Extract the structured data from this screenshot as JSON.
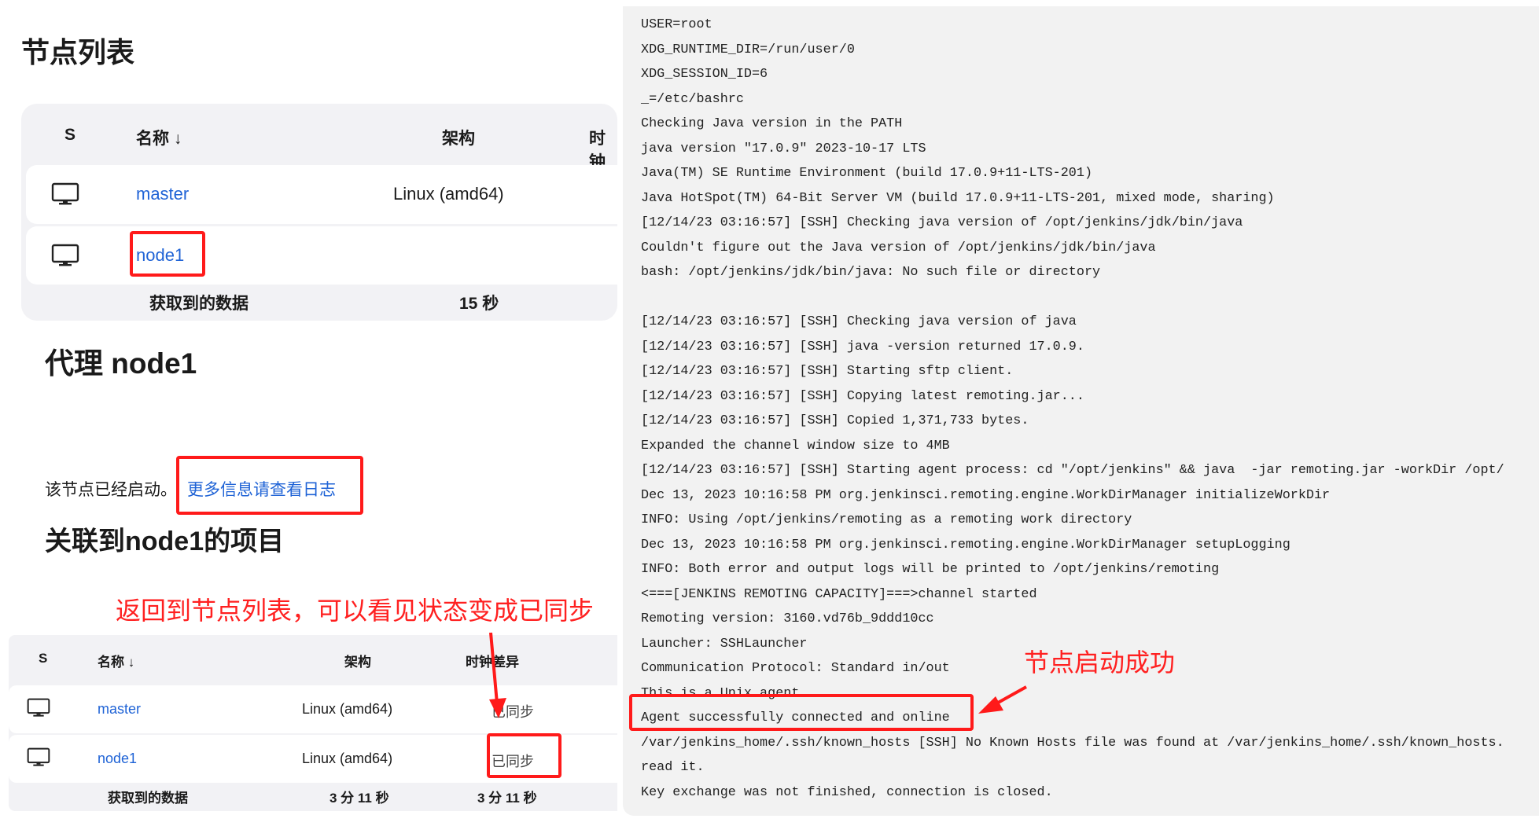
{
  "nodes_page": {
    "title": "节点列表",
    "table": {
      "headers": {
        "status": "S",
        "name": "名称 ↓",
        "arch": "架构",
        "clock": "时钟"
      },
      "rows": [
        {
          "name": "master",
          "arch": "Linux (amd64)",
          "icon": "monitor-icon"
        },
        {
          "name": "node1",
          "arch": "",
          "icon": "monitor-icon"
        }
      ],
      "footer": {
        "label": "获取到的数据",
        "arch": "15 秒"
      }
    }
  },
  "agent_page": {
    "title": "代理 node1",
    "status_text": "该节点已经启动。",
    "log_link": "更多信息请查看日志",
    "projects_title": "关联到node1的项目"
  },
  "annotations": {
    "back_to_list": "返回到节点列表，可以看见状态变成已同步",
    "node_started": "节点启动成功",
    "highlight_color": "#ff1a1a"
  },
  "nodes_page_2": {
    "table": {
      "headers": {
        "status": "S",
        "name": "名称 ↓",
        "arch": "架构",
        "clock": "时钟差异"
      },
      "rows": [
        {
          "name": "master",
          "arch": "Linux (amd64)",
          "clock": "已同步"
        },
        {
          "name": "node1",
          "arch": "Linux (amd64)",
          "clock": "已同步"
        }
      ],
      "footer": {
        "label": "获取到的数据",
        "arch": "3 分 11 秒",
        "clock": "3 分 11 秒"
      }
    }
  },
  "log": {
    "lines": [
      "USER=root",
      "XDG_RUNTIME_DIR=/run/user/0",
      "XDG_SESSION_ID=6",
      "_=/etc/bashrc",
      "Checking Java version in the PATH",
      "java version \"17.0.9\" 2023-10-17 LTS",
      "Java(TM) SE Runtime Environment (build 17.0.9+11-LTS-201)",
      "Java HotSpot(TM) 64-Bit Server VM (build 17.0.9+11-LTS-201, mixed mode, sharing)",
      "[12/14/23 03:16:57] [SSH] Checking java version of /opt/jenkins/jdk/bin/java",
      "Couldn't figure out the Java version of /opt/jenkins/jdk/bin/java",
      "bash: /opt/jenkins/jdk/bin/java: No such file or directory",
      "",
      "[12/14/23 03:16:57] [SSH] Checking java version of java",
      "[12/14/23 03:16:57] [SSH] java -version returned 17.0.9.",
      "[12/14/23 03:16:57] [SSH] Starting sftp client.",
      "[12/14/23 03:16:57] [SSH] Copying latest remoting.jar...",
      "[12/14/23 03:16:57] [SSH] Copied 1,371,733 bytes.",
      "Expanded the channel window size to 4MB",
      "[12/14/23 03:16:57] [SSH] Starting agent process: cd \"/opt/jenkins\" && java  -jar remoting.jar -workDir /opt/",
      "Dec 13, 2023 10:16:58 PM org.jenkinsci.remoting.engine.WorkDirManager initializeWorkDir",
      "INFO: Using /opt/jenkins/remoting as a remoting work directory",
      "Dec 13, 2023 10:16:58 PM org.jenkinsci.remoting.engine.WorkDirManager setupLogging",
      "INFO: Both error and output logs will be printed to /opt/jenkins/remoting",
      "<===[JENKINS REMOTING CAPACITY]===>channel started",
      "Remoting version: 3160.vd76b_9ddd10cc",
      "Launcher: SSHLauncher",
      "Communication Protocol: Standard in/out",
      "This is a Unix agent",
      "Agent successfully connected and online",
      "/var/jenkins_home/.ssh/known_hosts [SSH] No Known Hosts file was found at /var/jenkins_home/.ssh/known_hosts.",
      "read it.",
      "Key exchange was not finished, connection is closed."
    ]
  }
}
